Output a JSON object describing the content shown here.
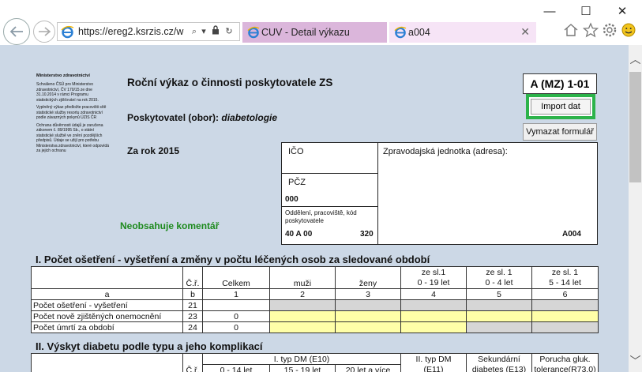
{
  "browser": {
    "url": "https://ereg2.ksrzis.cz/we",
    "tabs": [
      {
        "label": "CUV - Detail výkazu"
      },
      {
        "label": "a004"
      }
    ],
    "window_controls": {
      "minimize": "—",
      "maximize": "☐",
      "close": "✕"
    }
  },
  "ministry_note": {
    "heading": "Ministerstvo zdravotnictví",
    "p1": "Schváleno ČSÚ pro Ministerstvo zdravotnictví, ČV 170/15 ze dne 31.10.2014 v rámci Programu statistických zjišťování na rok 2015.",
    "p2": "Vyplněný výkaz předložte pracovišti sítě statistické služby resortu zdravotnictví podle závazných pokynů ÚZIS ČR",
    "p3": "Ochrana důvěrnosti údajů je zaručena zákonem č. 89/1995 Sb., o státní statistické službě ve znění pozdějších předpisů. Údaje se užijí pro potřebu Ministerstva zdravotnictví, které odpovídá za jejich ochranu"
  },
  "form": {
    "title": "Roční výkaz o činnosti poskytovatele ZS",
    "provider_label": "Poskytovatel (obor):",
    "provider_value": "diabetologie",
    "year_label": "Za rok 2015",
    "no_comment": "Neobsahuje komentář",
    "code": "A (MZ) 1-01",
    "import_button": "Import dat",
    "clear_button": "Vymazat formulář"
  },
  "idbox": {
    "ico_label": "IČO",
    "ico_value": "",
    "pcz_label": "PČZ",
    "pcz_value": "000",
    "dept_label_1": "Oddělení, pracoviště, kód",
    "dept_label_2": "poskytovatele",
    "dept_value": "40 A 00",
    "dept_number": "320",
    "reporting_unit_label": "Zpravodajská jednotka (adresa):",
    "reporting_unit_code": "A004"
  },
  "section1": {
    "title": "I. Počet ošetření - vyšetření a změny v počtu léčených osob za sledované období",
    "headers": {
      "cr": "Č.ř.",
      "celkem": "Celkem",
      "muzi": "muži",
      "zeny": "ženy",
      "g1a": "ze sl.1",
      "g1b": "0 - 19 let",
      "g2a": "ze sl. 1",
      "g2b": "0 - 4 let",
      "g3a": "ze sl. 1",
      "g3b": "5 - 14 let"
    },
    "letters": [
      "a",
      "b",
      "1",
      "2",
      "3",
      "4",
      "5",
      "6"
    ],
    "rows": [
      {
        "label": "Počet ošetření - vyšetření",
        "cr": "21",
        "celkem": ""
      },
      {
        "label": "Počet nově zjištěných onemocnění",
        "cr": "23",
        "celkem": "0"
      },
      {
        "label": "Počet úmrtí za období",
        "cr": "24",
        "celkem": "0"
      }
    ]
  },
  "section2": {
    "title": "II. Výskyt diabetu podle typu a jeho komplikací",
    "headers": {
      "cr": "Č.ř.",
      "typ1": "I. typ DM (E10)",
      "typ1_a": "0 - 14 let",
      "typ1_b": "15 - 19 let",
      "typ1_c": "20 let a více",
      "typ2a": "II. typ DM",
      "typ2b": "(E11)",
      "sek_a": "Sekundární",
      "sek_b": "diabetes (E13)",
      "por_a": "Porucha gluk.",
      "por_b": "tolerance(R73.0)"
    }
  }
}
